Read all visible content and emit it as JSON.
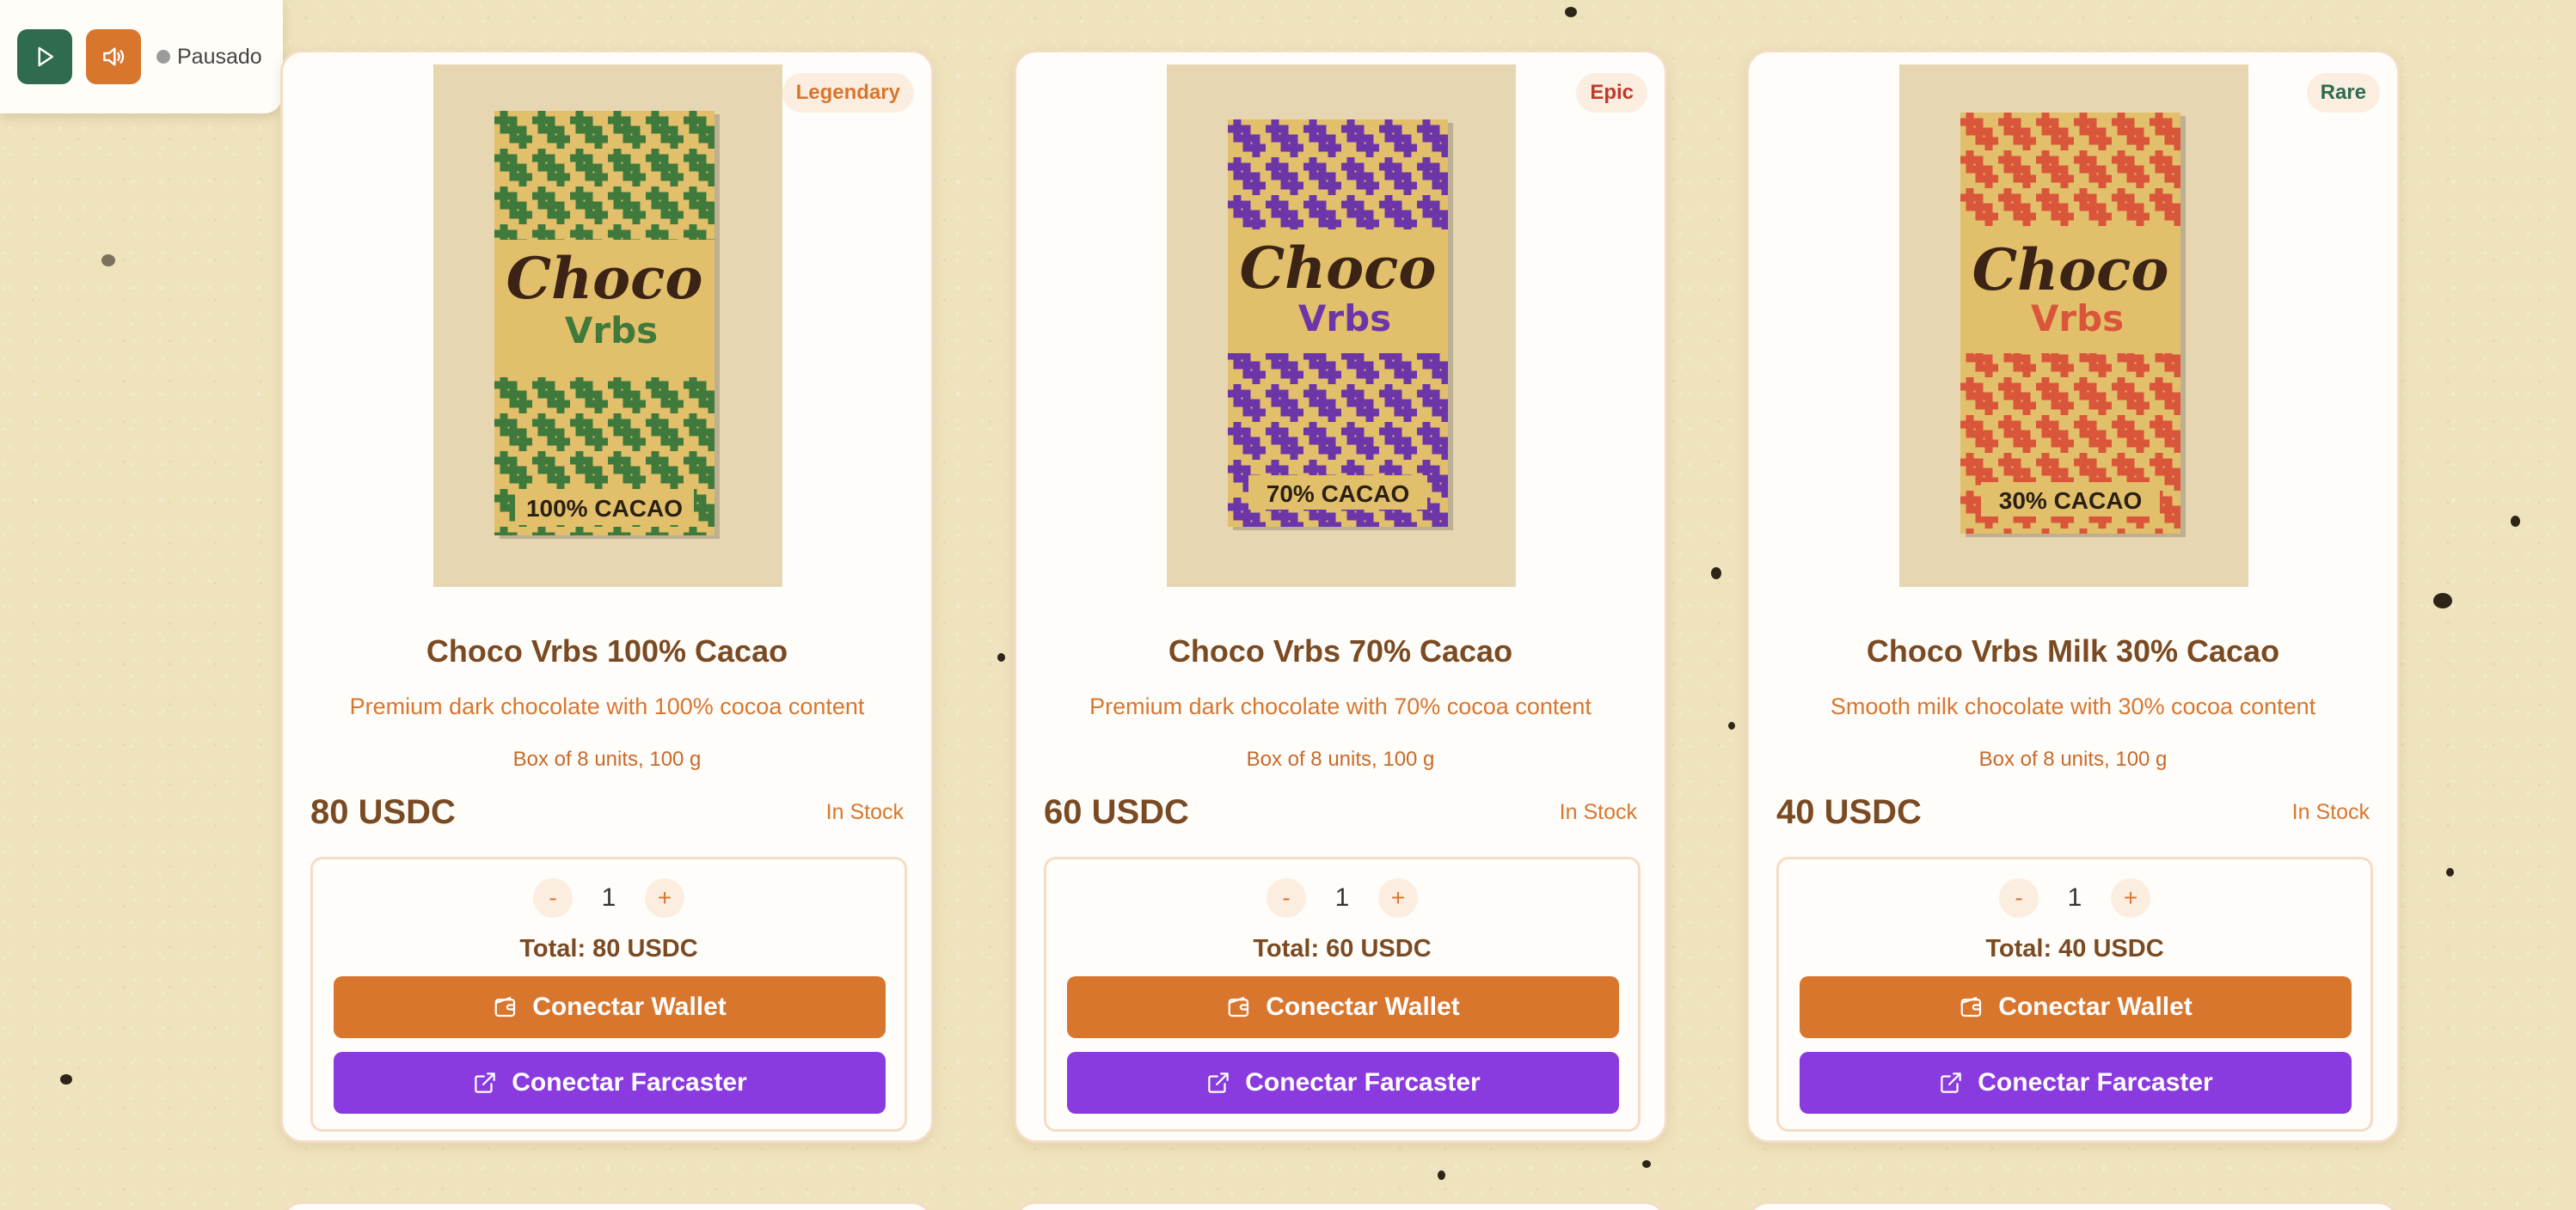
{
  "audio": {
    "status": "Pausado",
    "play_icon": "play-icon",
    "sound_icon": "volume-icon"
  },
  "colors": {
    "background": "#efe3bd",
    "accent_orange": "#d9762e",
    "accent_purple": "#8a3be0",
    "text_brown": "#7a4a23",
    "play_green": "#2f6b4f"
  },
  "products": [
    {
      "rarity": "Legendary",
      "title": "Choco Vrbs 100% Cacao",
      "description": "Premium dark chocolate with 100% cocoa content",
      "box_info": "Box of 8 units, 100 g",
      "price": "80 USDC",
      "stock": "In Stock",
      "quantity": "1",
      "total": "Total: 80 USDC",
      "pack_brand": "Choco",
      "pack_sub": "Vrbs",
      "pack_label": "100% CACAO",
      "pack_color": "#3f7a3c",
      "wallet_label": "Conectar Wallet",
      "farcaster_label": "Conectar Farcaster"
    },
    {
      "rarity": "Epic",
      "title": "Choco Vrbs 70% Cacao",
      "description": "Premium dark chocolate with 70% cocoa content",
      "box_info": "Box of 8 units, 100 g",
      "price": "60 USDC",
      "stock": "In Stock",
      "quantity": "1",
      "total": "Total: 60 USDC",
      "pack_brand": "Choco",
      "pack_sub": "Vrbs",
      "pack_label": "70% CACAO",
      "pack_color": "#6c36a8",
      "wallet_label": "Conectar Wallet",
      "farcaster_label": "Conectar Farcaster"
    },
    {
      "rarity": "Rare",
      "title": "Choco Vrbs Milk 30% Cacao",
      "description": "Smooth milk chocolate with 30% cocoa content",
      "box_info": "Box of 8 units, 100 g",
      "price": "40 USDC",
      "stock": "In Stock",
      "quantity": "1",
      "total": "Total: 40 USDC",
      "pack_brand": "Choco",
      "pack_sub": "Vrbs",
      "pack_label": "30% CACAO",
      "pack_color": "#d9563a",
      "wallet_label": "Conectar Wallet",
      "farcaster_label": "Conectar Farcaster"
    }
  ],
  "controls": {
    "minus": "-",
    "plus": "+"
  }
}
